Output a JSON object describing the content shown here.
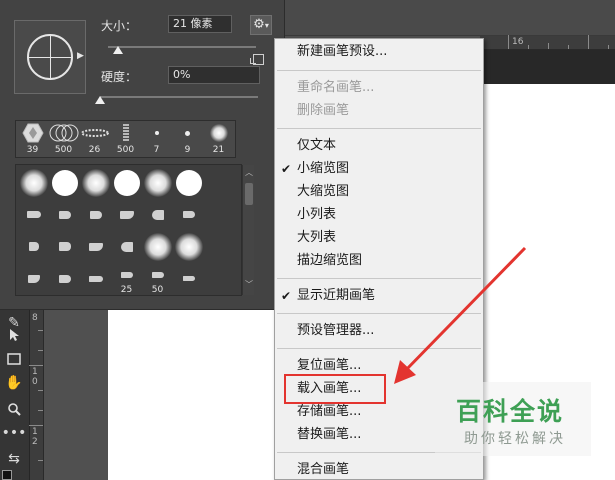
{
  "ruler_top": {
    "label": "16"
  },
  "ruler_left": {
    "labels": [
      "8",
      "1",
      "0",
      "1",
      "2"
    ]
  },
  "brush_panel": {
    "size_label": "大小：",
    "size_value": "21 像素",
    "hardness_label": "硬度：",
    "hardness_value": "0%",
    "size_fraction": 0.07,
    "hardness_fraction": 0.0,
    "gear_icon": "gear-icon",
    "recent_brushes": [
      {
        "size": "39",
        "icon": "hexagon-brush-icon"
      },
      {
        "size": "500",
        "icon": "circles-brush-icon"
      },
      {
        "size": "26",
        "icon": "dots-brush-icon"
      },
      {
        "size": "500",
        "icon": "spring-brush-icon"
      },
      {
        "size": "7",
        "icon": "small-dot-brush-icon"
      },
      {
        "size": "9",
        "icon": "small-dot-brush-icon"
      },
      {
        "size": "21",
        "icon": "soft-round-brush-icon"
      }
    ],
    "grid_numbers": {
      "bristle_25": "25",
      "bristle_50": "50"
    }
  },
  "menu": {
    "items": [
      {
        "label": "新建画笔预设...",
        "disabled": false,
        "checked": false
      },
      {
        "label": "重命名画笔...",
        "disabled": true,
        "checked": false
      },
      {
        "label": "删除画笔",
        "disabled": true,
        "checked": false
      },
      {
        "label": "仅文本",
        "disabled": false,
        "checked": false
      },
      {
        "label": "小缩览图",
        "disabled": false,
        "checked": true
      },
      {
        "label": "大缩览图",
        "disabled": false,
        "checked": false
      },
      {
        "label": "小列表",
        "disabled": false,
        "checked": false
      },
      {
        "label": "大列表",
        "disabled": false,
        "checked": false
      },
      {
        "label": "描边缩览图",
        "disabled": false,
        "checked": false
      },
      {
        "label": "显示近期画笔",
        "disabled": false,
        "checked": true
      },
      {
        "label": "预设管理器...",
        "disabled": false,
        "checked": false
      },
      {
        "label": "复位画笔...",
        "disabled": false,
        "checked": false
      },
      {
        "label": "载入画笔...",
        "disabled": false,
        "checked": false
      },
      {
        "label": "存储画笔...",
        "disabled": false,
        "checked": false
      },
      {
        "label": "替换画笔...",
        "disabled": false,
        "checked": false
      },
      {
        "label": "混合画笔",
        "disabled": false,
        "checked": false
      }
    ],
    "check_glyph": "✔"
  },
  "watermark": {
    "title": "百科全说",
    "subtitle": "助你轻松解决"
  },
  "colors": {
    "highlight": "#e3342f",
    "watermark_green": "#3ea055",
    "panel": "#434343",
    "menu_bg": "#f0f0f0"
  }
}
